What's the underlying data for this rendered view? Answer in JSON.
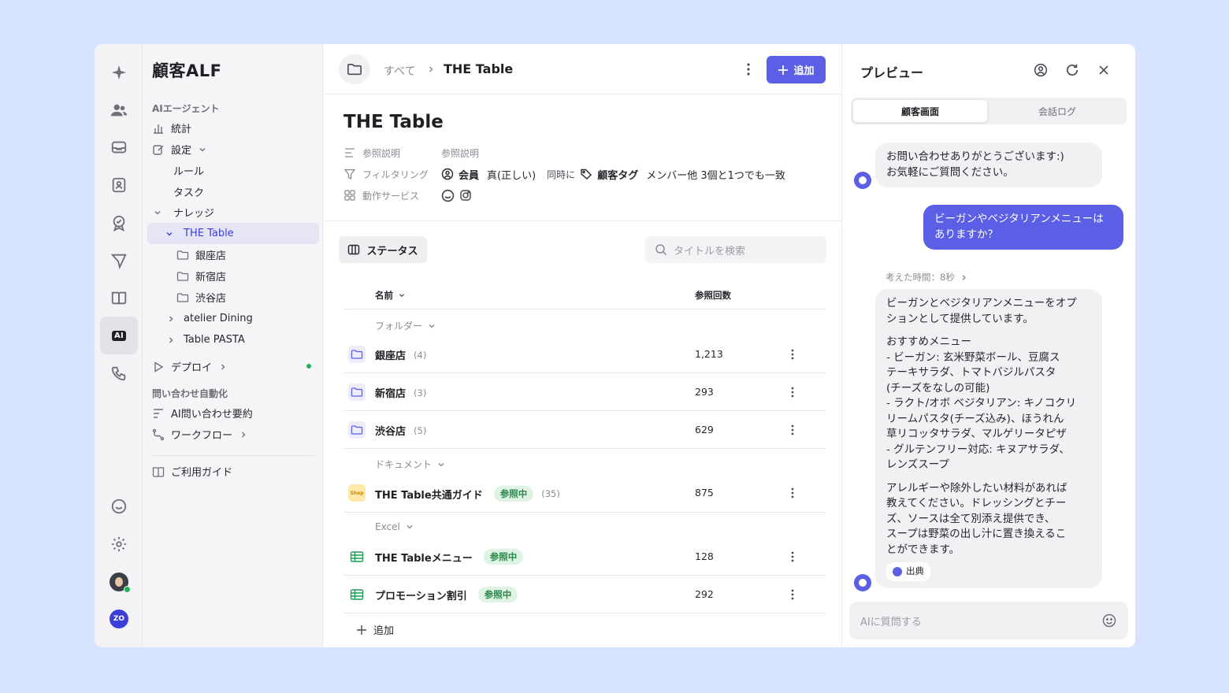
{
  "sidebar": {
    "title": "顧客ALF",
    "section_ai": "AIエージェント",
    "items": {
      "stats": "統計",
      "settings": "設定",
      "rules": "ルール",
      "tasks": "タスク",
      "knowledge": "ナレッジ",
      "the_table": "THE Table",
      "ginza": "銀座店",
      "shinjuku": "新宿店",
      "shibuya": "渋谷店",
      "atelier": "atelier Dining",
      "pasta": "Table PASTA",
      "deploy": "デプロイ"
    },
    "section_auto": "問い合わせ自動化",
    "summary": "AI問い合わせ要約",
    "workflow": "ワークフロー",
    "guide": "ご利用ガイド"
  },
  "topbar": {
    "crumb_all": "すべて",
    "crumb_current": "THE Table",
    "add_label": "追加"
  },
  "detail": {
    "title": "THE Table",
    "meta": {
      "ref_label": "参照説明",
      "ref_value": "参照説明",
      "filter_label": "フィルタリング",
      "filter_member": "会員",
      "filter_true": "真(正しい)",
      "filter_and": "同時に",
      "filter_tag": "顧客タグ",
      "filter_rule": "メンバー他 3個と1つでも一致",
      "service_label": "動作サービス"
    }
  },
  "toolbar": {
    "status_label": "ステータス",
    "search_placeholder": "タイトルを検索"
  },
  "table": {
    "col_name": "名前",
    "col_count": "参照回数",
    "group_folder": "フォルダー",
    "group_doc": "ドキュメント",
    "group_excel": "Excel",
    "rows": [
      {
        "name": "銀座店",
        "sub": "(4)",
        "count": "1,213"
      },
      {
        "name": "新宿店",
        "sub": "(3)",
        "count": "293"
      },
      {
        "name": "渋谷店",
        "sub": "(5)",
        "count": "629"
      },
      {
        "name": "THE Table共通ガイド",
        "badge": "参照中",
        "sub": "(35)",
        "count": "875",
        "icon_text": "Shop"
      },
      {
        "name": "THE Tableメニュー",
        "badge": "参照中",
        "count": "128"
      },
      {
        "name": "プロモーション割引",
        "badge": "参照中",
        "count": "292"
      }
    ],
    "add_label": "追加"
  },
  "preview": {
    "title": "プレビュー",
    "tab_customer": "顧客画面",
    "tab_log": "会話ログ",
    "msg1_l1": "お問い合わせありがとうございます:)",
    "msg1_l2": "お気軽にご質問ください。",
    "user_l1": "ビーガンやベジタリアンメニューは",
    "user_l2": "ありますか？",
    "think": "考えた時間：8秒",
    "ans": [
      "ビーガンとベジタリアンメニューをオプ",
      "ションとして提供しています。",
      "おすすめメニュー",
      "- ビーガン: 玄米野菜ボール、豆腐ス",
      "テーキサラダ、トマトバジルパスタ",
      "(チーズをなしの可能)",
      "- ラクト/オボ ベジタリアン: キノコクリ",
      "リームパスタ(チーズ込み)、ほうれん",
      "草リコッタサラダ、マルゲリータピザ",
      "- グルテンフリー対応: キヌアサラダ、",
      "レンズスープ",
      "アレルギーや除外したい材料があれば",
      "教えてください。ドレッシングとチー",
      "ズ、ソースは全て別添え提供でき、",
      "スープは野菜の出し汁に置き換えるこ",
      "とができます。"
    ],
    "source": "出典",
    "input_placeholder": "AIに質問する"
  },
  "colors": {
    "accent": "#5b5fe6",
    "page_bg": "#d6e4ff",
    "online": "#22b357",
    "ref_badge_bg": "#dff3e5"
  }
}
